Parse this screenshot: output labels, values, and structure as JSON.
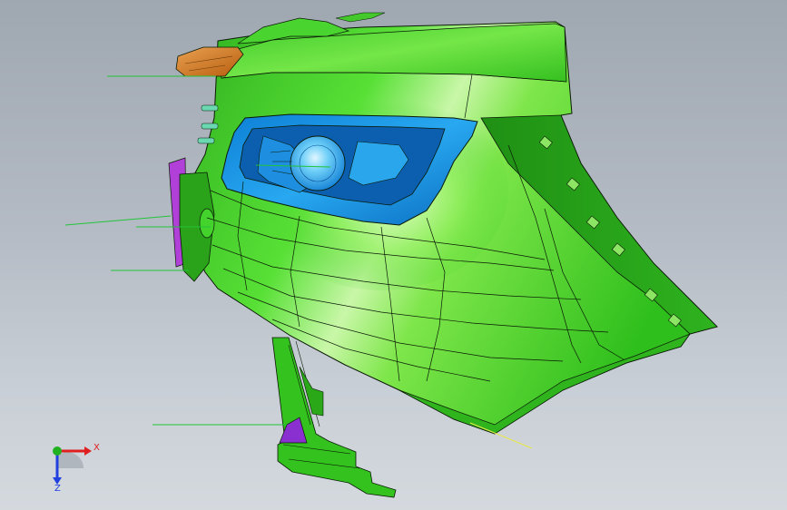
{
  "viewport": {
    "background_top": "#9fa7b1",
    "background_bottom": "#d4d9de"
  },
  "model": {
    "parts": [
      {
        "name": "bumper-body",
        "color": "#3fd22a"
      },
      {
        "name": "fog-lamp-bezel",
        "color": "#1f9ff0"
      },
      {
        "name": "fog-lamp-lens",
        "color": "#58c8f5"
      },
      {
        "name": "tow-hook-cover",
        "color": "#d2781e"
      },
      {
        "name": "side-bracket",
        "color": "#b040d8"
      },
      {
        "name": "lower-bracket-tab",
        "color": "#8a2fd0"
      }
    ],
    "edge_color": "#0a1a06",
    "leader_line_color": "#22c43a",
    "datum_line_color": "#e8e84a"
  },
  "triad": {
    "x_label": "X",
    "y_label": "Y",
    "z_label": "Z",
    "x_color": "#e02020",
    "y_color": "#20b020",
    "z_color": "#2040e0"
  }
}
